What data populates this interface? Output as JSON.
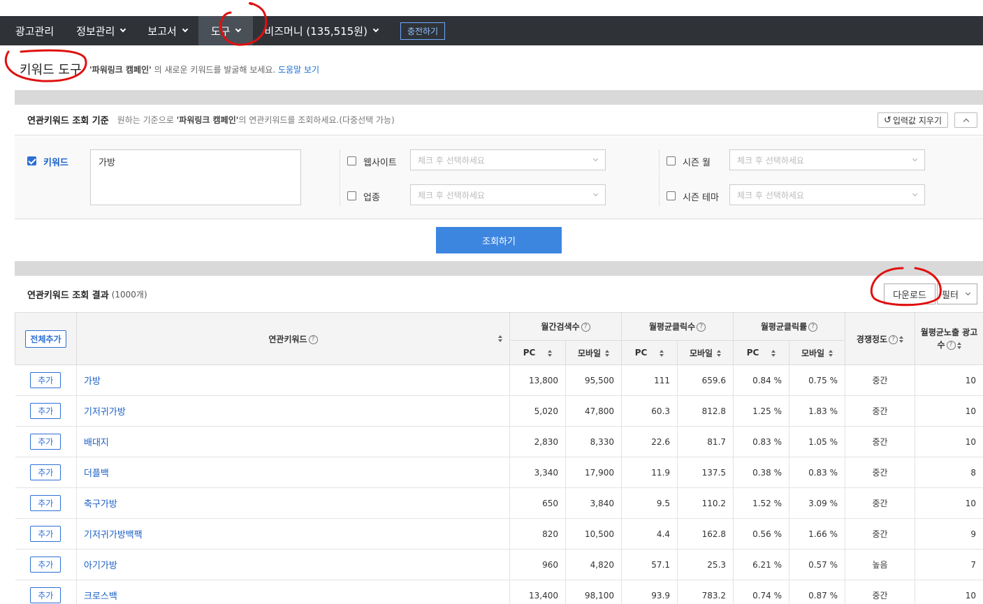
{
  "nav": {
    "items": [
      {
        "label": "광고관리",
        "has_chevron": false,
        "active": false
      },
      {
        "label": "정보관리",
        "has_chevron": true,
        "active": false
      },
      {
        "label": "보고서",
        "has_chevron": true,
        "active": false
      },
      {
        "label": "도구",
        "has_chevron": true,
        "active": true
      },
      {
        "label": "비즈머니 (135,515원)",
        "has_chevron": true,
        "active": false
      }
    ],
    "charge_label": "충전하기"
  },
  "page": {
    "title": "키워드 도구",
    "sub_quote": "'파워링크 캠페인'",
    "sub_text": " 의 새로운 키워드를 발굴해 보세요. ",
    "help_link": "도움말 보기"
  },
  "criteria": {
    "title": "연관키워드 조회 기준",
    "desc_pre": "원하는 기준으로 ",
    "desc_quote": "'파워링크 캠페인'",
    "desc_post": "의 연관키워드를 조회하세요.(다중선택 가능)",
    "reset_label": "입력값 지우기",
    "keyword_label": "키워드",
    "keyword_value": "가방",
    "website_label": "웹사이트",
    "industry_label": "업종",
    "season_month_label": "시즌 월",
    "season_theme_label": "시즌 테마",
    "select_placeholder": "체크 후 선택하세요",
    "search_label": "조회하기"
  },
  "results": {
    "title": "연관키워드 조회 결과",
    "count": "(1000개)",
    "download_label": "다운로드",
    "filter_label": "필터",
    "add_all_label": "전체추가",
    "add_label": "추가",
    "headers": {
      "keyword": "연관키워드",
      "monthly_search": "월간검색수",
      "avg_clicks": "월평균클릭수",
      "avg_ctr": "월평균클릭률",
      "competition": "경쟁정도",
      "avg_ads": "월평균노출 광고수",
      "pc": "PC",
      "mobile": "모바일"
    },
    "rows": [
      {
        "kw": "가방",
        "s_pc": "13,800",
        "s_mo": "95,500",
        "c_pc": "111",
        "c_mo": "659.6",
        "r_pc": "0.84 %",
        "r_mo": "0.75 %",
        "comp": "중간",
        "ads": "10"
      },
      {
        "kw": "기저귀가방",
        "s_pc": "5,020",
        "s_mo": "47,800",
        "c_pc": "60.3",
        "c_mo": "812.8",
        "r_pc": "1.25 %",
        "r_mo": "1.83 %",
        "comp": "중간",
        "ads": "10"
      },
      {
        "kw": "배대지",
        "s_pc": "2,830",
        "s_mo": "8,330",
        "c_pc": "22.6",
        "c_mo": "81.7",
        "r_pc": "0.83 %",
        "r_mo": "1.05 %",
        "comp": "중간",
        "ads": "10"
      },
      {
        "kw": "더플백",
        "s_pc": "3,340",
        "s_mo": "17,900",
        "c_pc": "11.9",
        "c_mo": "137.5",
        "r_pc": "0.38 %",
        "r_mo": "0.83 %",
        "comp": "중간",
        "ads": "8"
      },
      {
        "kw": "축구가방",
        "s_pc": "650",
        "s_mo": "3,840",
        "c_pc": "9.5",
        "c_mo": "110.2",
        "r_pc": "1.52 %",
        "r_mo": "3.09 %",
        "comp": "중간",
        "ads": "10"
      },
      {
        "kw": "기저귀가방백팩",
        "s_pc": "820",
        "s_mo": "10,500",
        "c_pc": "4.4",
        "c_mo": "162.8",
        "r_pc": "0.56 %",
        "r_mo": "1.66 %",
        "comp": "중간",
        "ads": "9"
      },
      {
        "kw": "아기가방",
        "s_pc": "960",
        "s_mo": "4,820",
        "c_pc": "57.1",
        "c_mo": "25.3",
        "r_pc": "6.21 %",
        "r_mo": "0.57 %",
        "comp": "높음",
        "ads": "7"
      },
      {
        "kw": "크로스백",
        "s_pc": "13,400",
        "s_mo": "98,100",
        "c_pc": "93.9",
        "c_mo": "783.2",
        "r_pc": "0.74 %",
        "r_mo": "0.87 %",
        "comp": "중간",
        "ads": "10"
      }
    ]
  },
  "colors": {
    "accent": "#2d6fd6",
    "topbar": "#2f3338",
    "annotation": "#e01010"
  }
}
